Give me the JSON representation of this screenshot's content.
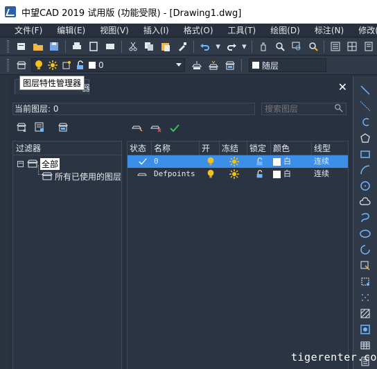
{
  "window": {
    "title": "中望CAD 2019 试用版 (功能受限) - [Drawing1.dwg]"
  },
  "menu": [
    "文件(F)",
    "编辑(E)",
    "视图(V)",
    "插入(I)",
    "格式(O)",
    "工具(T)",
    "绘图(D)",
    "标注(N)",
    "修改(M)"
  ],
  "layer_toolbar": {
    "current_layer_value": "0",
    "color_value": "随层"
  },
  "tooltip": "图层特性管理器",
  "panel": {
    "tab_tail": "器",
    "current_layer_label": "当前图层: 0",
    "search_placeholder": "搜索图层",
    "filter_header": "过滤器",
    "tree": {
      "root_label": "全部",
      "child_label": "所有已使用的图层"
    },
    "columns": {
      "status": "状态",
      "name": "名称",
      "on": "开",
      "freeze": "冻结",
      "lock": "锁定",
      "color": "颜色",
      "linetype": "线型"
    },
    "layers": [
      {
        "name": "0",
        "color": "白",
        "linetype": "连续",
        "selected": true
      },
      {
        "name": "Defpoints",
        "color": "白",
        "linetype": "连续",
        "selected": false
      }
    ]
  },
  "watermark": "tigerenter.com",
  "colors": {
    "accent": "#3b8fe8",
    "bulb": "#f5c21a",
    "sun": "#f5c21a"
  }
}
